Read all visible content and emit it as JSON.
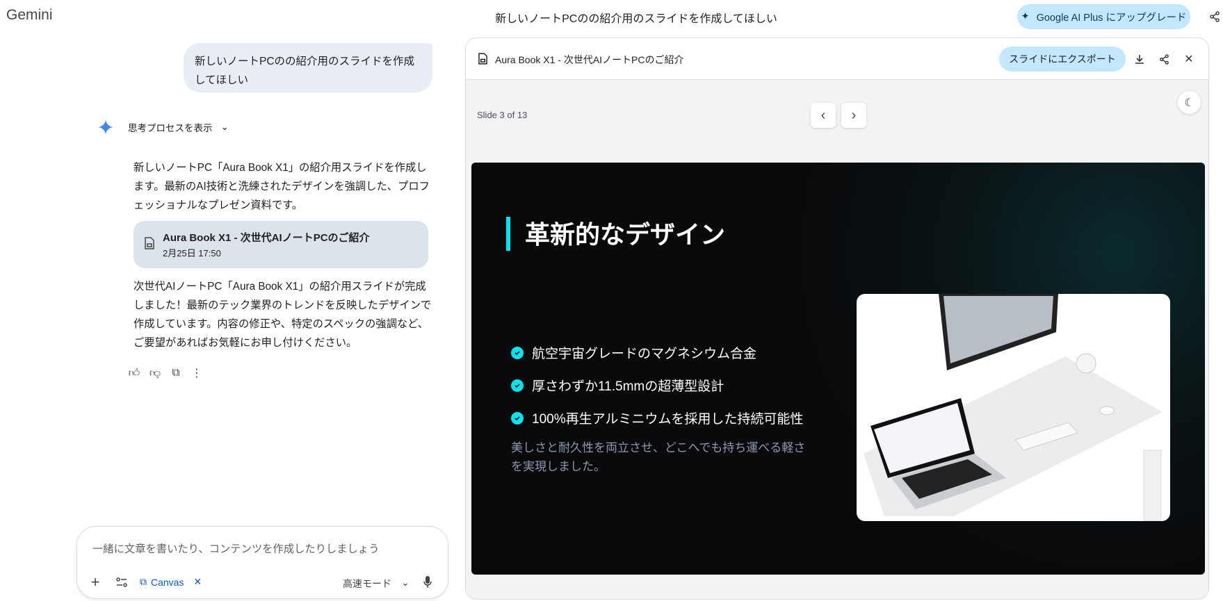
{
  "app": {
    "name": "Gemini",
    "conversation_title": "新しいノートPCのの紹介用のスライドを作成してほしい",
    "upgrade_label": "Google AI Plus にアップグレード"
  },
  "chat": {
    "user_message": "新しいノートPCのの紹介用のスライドを作成してほしい",
    "thinking_label": "思考プロセスを表示",
    "response_intro": "新しいノートPC「Aura Book X1」の紹介用スライドを作成します。最新のAI技術と洗練されたデザインを強調した、プロフェッショナルなプレゼン資料です。",
    "doc_card": {
      "title": "Aura Book X1 - 次世代AIノートPCのご紹介",
      "date": "2月25日 17:50"
    },
    "response_outro": "次世代AIノートPC「Aura Book X1」の紹介用スライドが完成しました！最新のテック業界のトレンドを反映したデザインで作成しています。内容の修正や、特定のスペックの強調など、ご要望があればお気軽にお申し付けください。"
  },
  "input": {
    "placeholder": "一緒に文章を書いたり、コンテンツを作成したりしましょう",
    "canvas_label": "Canvas",
    "mode_label": "高速モード"
  },
  "canvas": {
    "title": "Aura Book X1 - 次世代AIノートPCのご紹介",
    "export_label": "スライドにエクスポート",
    "slide_counter": "Slide 3 of 13",
    "current_slide": 3,
    "total_slides": 13,
    "slide": {
      "title": "革新的なデザイン",
      "bullets": [
        "航空宇宙グレードのマグネシウム合金",
        "厚さわずか11.5mmの超薄型設計",
        "100%再生アルミニウムを採用した持続可能性"
      ],
      "description": "美しさと耐久性を両立させ、どこへでも持ち運べる軽さを実現しました。"
    }
  },
  "colors": {
    "accent": "#00e5f0",
    "upgrade_bg": "#c2e7ff",
    "slide_bg": "#0a0a0c",
    "gemini_blue": "#4285f4"
  }
}
